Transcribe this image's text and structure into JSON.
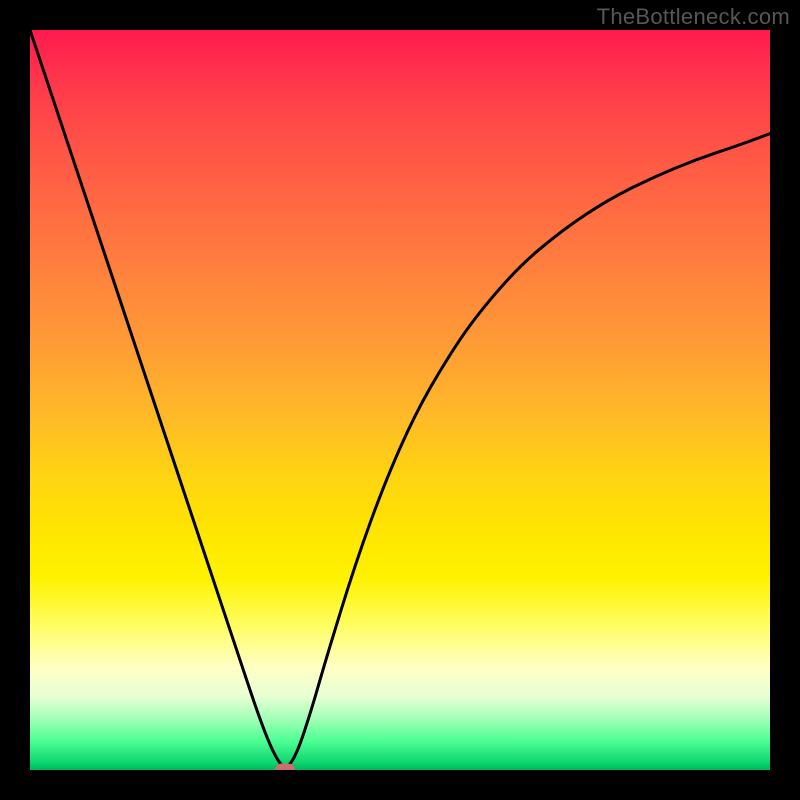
{
  "watermark": "TheBottleneck.com",
  "chart_data": {
    "type": "line",
    "title": "",
    "xlabel": "",
    "ylabel": "",
    "xlim": [
      0,
      100
    ],
    "ylim": [
      0,
      100
    ],
    "grid": false,
    "legend": false,
    "series": [
      {
        "name": "bottleneck-curve",
        "x": [
          0,
          4,
          8,
          12,
          16,
          20,
          24,
          28,
          31,
          33,
          34.5,
          36,
          38,
          40,
          44,
          48,
          52,
          56,
          60,
          66,
          72,
          78,
          84,
          90,
          96,
          100
        ],
        "y": [
          100,
          88,
          76,
          64,
          52,
          40,
          28,
          16,
          7,
          2,
          0,
          2,
          8,
          15,
          28,
          39,
          48,
          55,
          61,
          68,
          73,
          77,
          80,
          82.5,
          84.5,
          86
        ]
      }
    ],
    "marker": {
      "x": 34.5,
      "y": 0,
      "color": "#cc6d6f"
    },
    "background_gradient": {
      "stops": [
        {
          "pos": 0.0,
          "color": "#ff1a4e"
        },
        {
          "pos": 0.5,
          "color": "#ffb928"
        },
        {
          "pos": 0.7,
          "color": "#ffe600"
        },
        {
          "pos": 0.9,
          "color": "#e8ffd4"
        },
        {
          "pos": 1.0,
          "color": "#00b85d"
        }
      ]
    }
  }
}
